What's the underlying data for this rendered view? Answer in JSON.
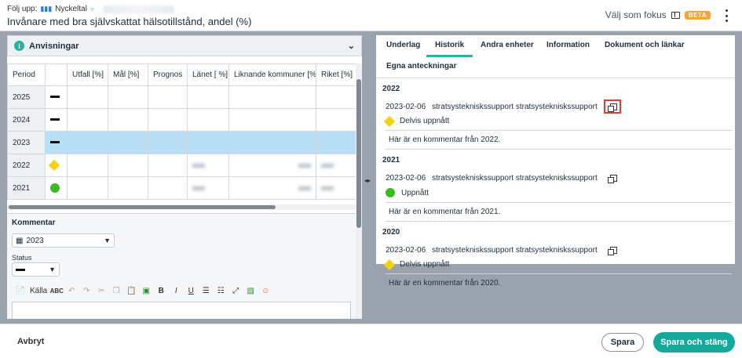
{
  "header": {
    "follow_label": "Följ upp:",
    "follow_type": "Nyckeltal",
    "title": "Invånare med bra självskattat hälsotillstånd, andel (%)",
    "focus_label": "Välj som fokus",
    "beta_label": "BETA"
  },
  "anvisningar": {
    "label": "Anvisningar"
  },
  "table": {
    "columns": [
      "Period",
      "",
      "Utfall [%]",
      "Mål [%]",
      "Prognos",
      "Länet [ %]",
      "Liknande kommuner [%]",
      "Riket [%]"
    ],
    "rows": [
      {
        "period": "2025",
        "status": "dash"
      },
      {
        "period": "2024",
        "status": "dash"
      },
      {
        "period": "2023",
        "status": "dash",
        "selected": true
      },
      {
        "period": "2022",
        "status": "diamond"
      },
      {
        "period": "2021",
        "status": "dot"
      }
    ]
  },
  "kommentar": {
    "label": "Kommentar",
    "period_value": "2023",
    "status_label": "Status",
    "toolbar": {
      "source_label": "Källa"
    }
  },
  "tabs": {
    "underlag": "Underlag",
    "historik": "Historik",
    "andra_enheter": "Andra enheter",
    "information": "Information",
    "dokument": "Dokument och länkar",
    "egna": "Egna anteckningar"
  },
  "history": [
    {
      "year": "2022",
      "date": "2023-02-06",
      "user": "stratsystekniskssupport stratsystekniskssupport",
      "status": "Delvis uppnått",
      "status_icon": "diamond",
      "comment": "Här är en kommentar från 2022."
    },
    {
      "year": "2021",
      "date": "2023-02-06",
      "user": "stratsystekniskssupport stratsystekniskssupport",
      "status": "Uppnått",
      "status_icon": "dot",
      "comment": "Här är en kommentar från 2021."
    },
    {
      "year": "2020",
      "date": "2023-02-06",
      "user": "stratsystekniskssupport stratsystekniskssupport",
      "status": "Delvis uppnått",
      "status_icon": "diamond",
      "comment": "Här är en kommentar från 2020."
    }
  ],
  "footer": {
    "cancel": "Avbryt",
    "save": "Spara",
    "save_close": "Spara och stäng"
  },
  "colors": {
    "accent": "#16a99b",
    "selected_row": "#b9dff4",
    "partial": "#f5d313",
    "achieved": "#3cba22",
    "highlight": "#e53935"
  }
}
